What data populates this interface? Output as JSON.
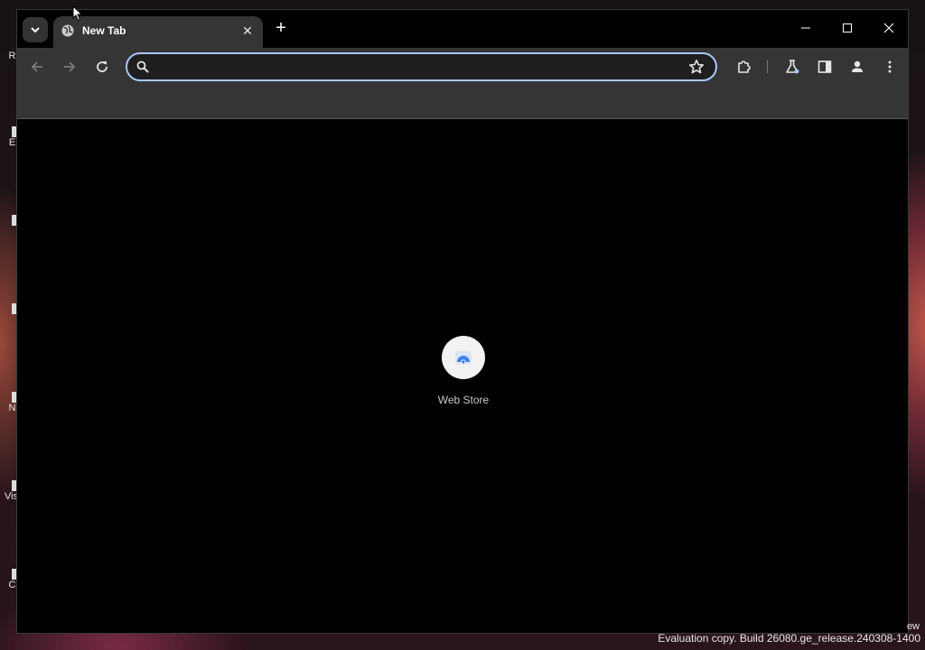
{
  "desktop": {
    "icon_labels": [
      "R",
      "E",
      "",
      "",
      "N",
      "Vis",
      "C"
    ],
    "watermark": "Evaluation copy. Build 26080.ge_release.240308-1400",
    "corner_fragment": "ew"
  },
  "browser": {
    "tab": {
      "title": "New Tab"
    },
    "omnibox": {
      "value": "",
      "placeholder": ""
    },
    "shortcuts": [
      {
        "label": "Web Store"
      }
    ]
  },
  "icons": {
    "tab_search": "chevron-down-icon",
    "favicon": "globe-icon",
    "close": "close-icon",
    "new_tab": "plus-icon",
    "back": "arrow-left-icon",
    "forward": "arrow-right-icon",
    "reload": "reload-icon",
    "search": "search-icon",
    "bookmark": "star-icon",
    "extensions": "puzzle-icon",
    "labs": "flask-icon",
    "side_panel": "side-panel-icon",
    "profile": "person-icon",
    "menu": "kebab-menu-icon"
  },
  "colors": {
    "omnibox_focus": "#a8c7fa",
    "toolbar_bg": "#353535",
    "tab_bg": "#353535",
    "content_bg": "#000000"
  }
}
